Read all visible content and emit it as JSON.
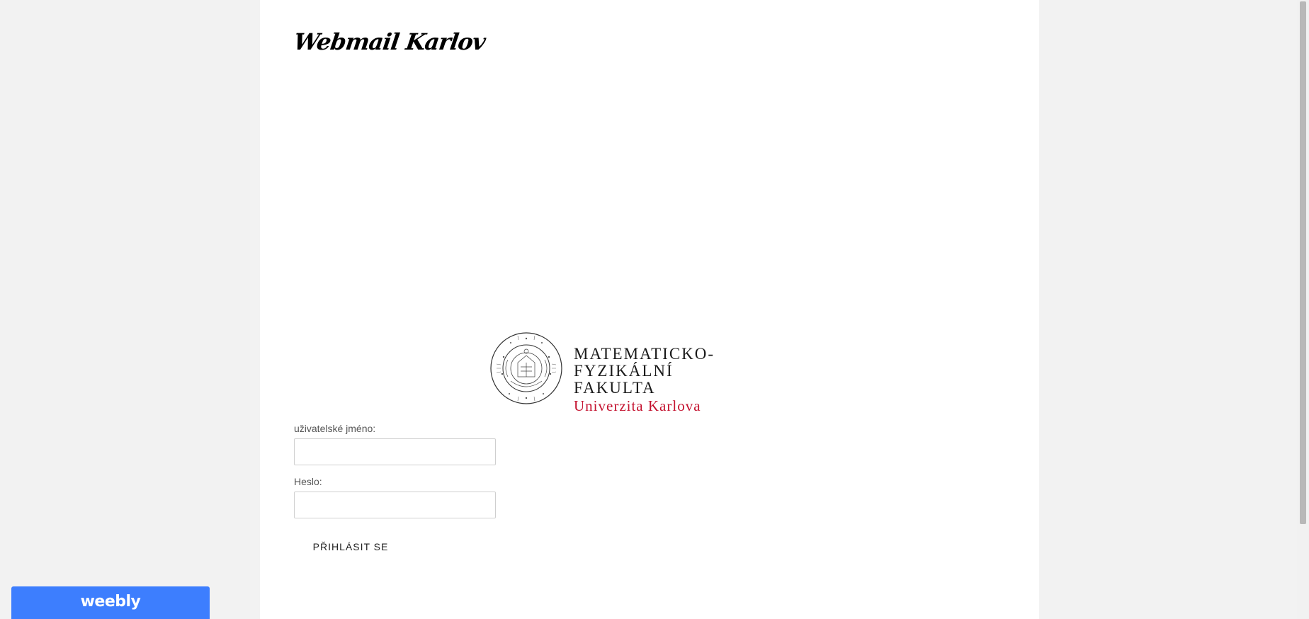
{
  "site": {
    "title": "Webmail Karlov"
  },
  "logo": {
    "line1": "MATEMATICKO-FYZIKÁLNÍ",
    "line2": "FAKULTA",
    "line3": "Univerzita Karlova",
    "seal_text": "MATHEMATICA PHYSICAQUE FACULTAS",
    "accent_color": "#c4122f"
  },
  "form": {
    "username_label": "uživatelské jméno:",
    "username_value": "",
    "password_label": "Heslo:",
    "password_value": "",
    "submit_label": "PŘIHLÁSIT SE"
  },
  "badge": {
    "label": "weebly",
    "color": "#3d7efe"
  }
}
